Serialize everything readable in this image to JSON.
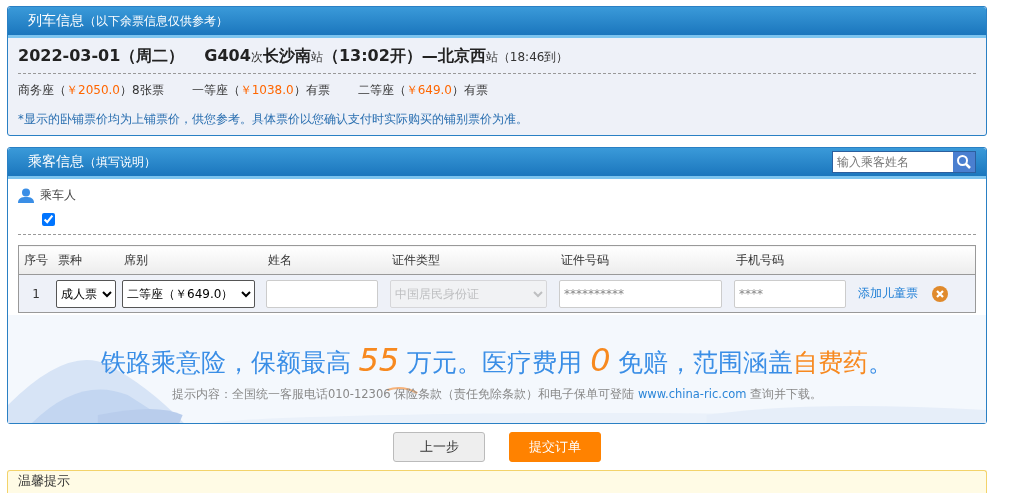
{
  "train_info": {
    "title": "列车信息",
    "subtitle": "（以下余票信息仅供参考）",
    "trip": [
      {
        "text": "2022-03-01（周二）",
        "kind": "big",
        "gap": true
      },
      {
        "text": "G404",
        "kind": "big"
      },
      {
        "text": "次",
        "kind": "small"
      },
      {
        "text": "长沙南",
        "kind": "big"
      },
      {
        "text": "站",
        "kind": "small"
      },
      {
        "text": "（13:02开）—北京西",
        "kind": "big"
      },
      {
        "text": "站",
        "kind": "small"
      },
      {
        "text": "（18:46到）",
        "kind": "small"
      }
    ],
    "seats": [
      {
        "label": "商务座（",
        "price": "￥2050.0",
        "rest": "）8张票"
      },
      {
        "label": "一等座（",
        "price": "￥1038.0",
        "rest": "）有票"
      },
      {
        "label": "二等座（",
        "price": "￥649.0",
        "rest": "）有票"
      }
    ],
    "note": "*显示的卧铺票价均为上铺票价，供您参考。具体票价以您确认支付时实际购买的铺别票价为准。"
  },
  "passenger_info": {
    "title": "乘客信息",
    "subtitle": "（填写说明）",
    "search": {
      "placeholder": "输入乘客姓名"
    },
    "passenger_label": "乘车人",
    "passenger_checked": true,
    "columns": [
      "序号",
      "票种",
      "席别",
      "姓名",
      "证件类型",
      "证件号码",
      "手机号码"
    ],
    "rows": [
      {
        "index": "1",
        "ticket_type": "成人票",
        "seat": "二等座（￥649.0）",
        "id_type": "中国居民身份证",
        "id_type_disabled": true,
        "id_number": "**********",
        "phone": "****",
        "add_child": "添加儿童票"
      }
    ],
    "banner": {
      "headline": [
        {
          "text": "铁路乘意险，保额最高 ",
          "highlight": false
        },
        {
          "text": "55",
          "highlight": true,
          "big": true
        },
        {
          "text": " 万元。医疗费用 ",
          "highlight": false
        },
        {
          "text": "0",
          "highlight": true,
          "big": true
        },
        {
          "text": " 免赔，范围涵盖",
          "highlight": false
        },
        {
          "text": "自费药",
          "highlight": true
        },
        {
          "text": "。",
          "highlight": false
        }
      ],
      "note_before": "提示内容：全国统一客服电话010-12306 保险条款（责任免除条款）和电子保单可登陆 ",
      "link": "www.china-ric.com",
      "note_after": " 查询并下载。"
    }
  },
  "buttons": [
    {
      "label": "上一步",
      "kind": "secondary"
    },
    {
      "label": "提交订单",
      "kind": "primary"
    }
  ],
  "tips": {
    "title": "温馨提示"
  }
}
